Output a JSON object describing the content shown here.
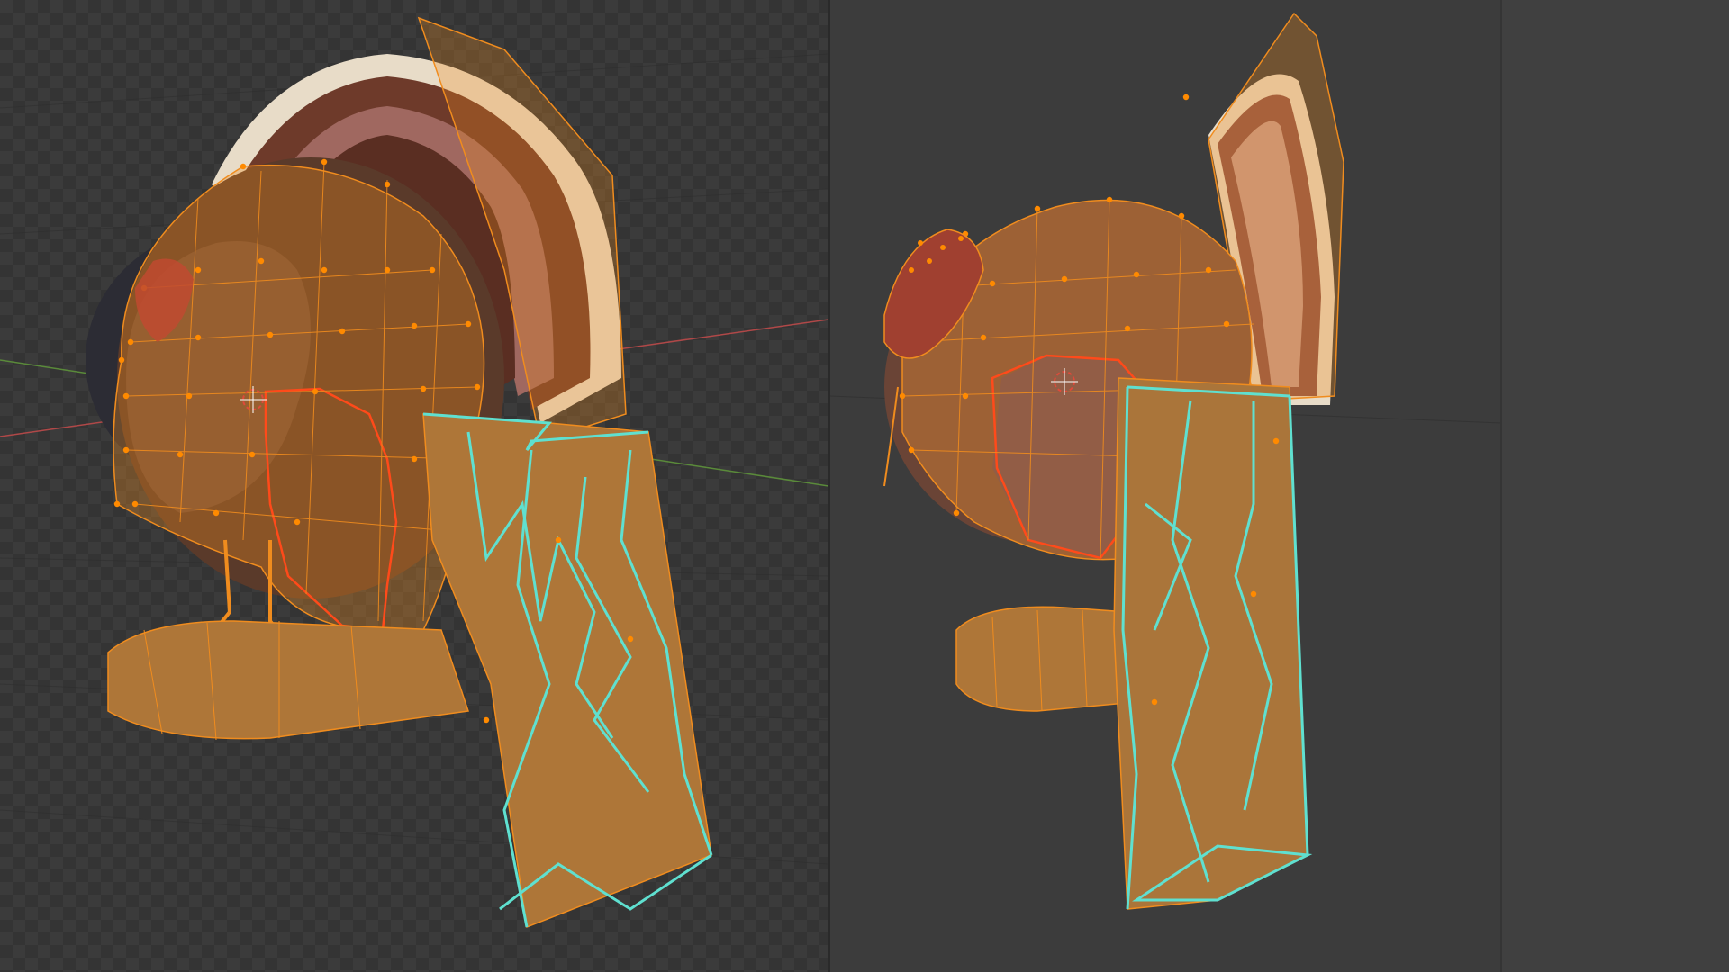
{
  "viewports": [
    {
      "id": "left",
      "view": "front-perspective",
      "object": "turkey-on-branch",
      "mode": "edit-mesh"
    },
    {
      "id": "right",
      "view": "side-perspective",
      "object": "turkey-on-branch",
      "mode": "edit-mesh"
    }
  ],
  "colors": {
    "viewport_bg_left": "#3b3b3b",
    "viewport_bg_right": "#3c3c3c",
    "sidebar_bg": "#404040",
    "wire_orange": "#f08c1e",
    "vertex_orange": "#ff8a00",
    "selected_edge_cyan": "#5fe0d0",
    "active_edge_red": "#ff4a1a",
    "x_axis_red": "#b04848",
    "y_axis_green": "#5a8a3a",
    "fan_cream": "#e8dcc8",
    "fan_brown": "#6e3a2a",
    "body_brown": "#5a3a2a",
    "wood": "#8a6a48"
  },
  "icons": [
    "3d-cursor-icon"
  ]
}
